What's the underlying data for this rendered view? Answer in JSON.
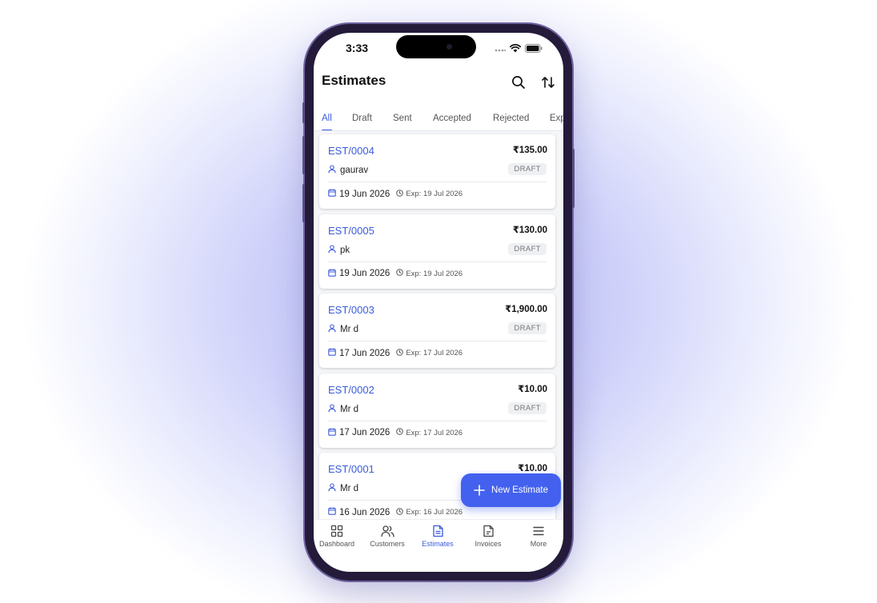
{
  "status": {
    "time": "3:33"
  },
  "header": {
    "title": "Estimates"
  },
  "tabs": [
    "All",
    "Draft",
    "Sent",
    "Accepted",
    "Rejected",
    "Exp"
  ],
  "estimates": [
    {
      "number": "EST/0004",
      "amount": "₹135.00",
      "customer": "gaurav",
      "status": "DRAFT",
      "date": "19 Jun 2026",
      "expiry": "Exp: 19 Jul 2026"
    },
    {
      "number": "EST/0005",
      "amount": "₹130.00",
      "customer": "pk",
      "status": "DRAFT",
      "date": "19 Jun 2026",
      "expiry": "Exp: 19 Jul 2026"
    },
    {
      "number": "EST/0003",
      "amount": "₹1,900.00",
      "customer": "Mr d",
      "status": "DRAFT",
      "date": "17 Jun 2026",
      "expiry": "Exp: 17 Jul 2026"
    },
    {
      "number": "EST/0002",
      "amount": "₹10.00",
      "customer": "Mr d",
      "status": "DRAFT",
      "date": "17 Jun 2026",
      "expiry": "Exp: 17 Jul 2026"
    },
    {
      "number": "EST/0001",
      "amount": "₹10.00",
      "customer": "Mr d",
      "status": "",
      "date": "16 Jun 2026",
      "expiry": "Exp: 16 Jul 2026"
    }
  ],
  "fab": {
    "label": "New Estimate"
  },
  "nav": [
    {
      "label": "Dashboard",
      "icon": "dashboard-icon"
    },
    {
      "label": "Customers",
      "icon": "customers-icon"
    },
    {
      "label": "Estimates",
      "icon": "estimates-icon"
    },
    {
      "label": "Invoices",
      "icon": "invoices-icon"
    },
    {
      "label": "More",
      "icon": "menu-icon"
    }
  ],
  "colors": {
    "accent": "#3b5bdb",
    "fab": "#4361ee"
  }
}
